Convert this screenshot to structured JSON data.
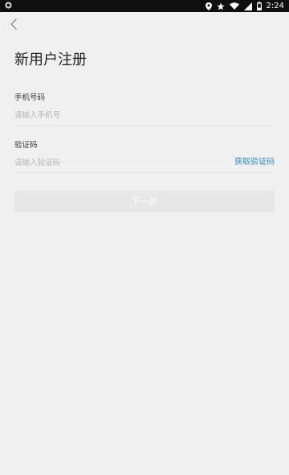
{
  "status_bar": {
    "time": "2:24",
    "icons": [
      "app-notification-icon",
      "location-icon",
      "star-icon",
      "wifi-icon",
      "signal-icon",
      "battery-icon"
    ]
  },
  "nav": {
    "back_icon": "chevron-left-icon"
  },
  "page": {
    "title": "新用户注册"
  },
  "form": {
    "phone": {
      "label": "手机号码",
      "placeholder": "请输入手机号",
      "value": ""
    },
    "code": {
      "label": "验证码",
      "placeholder": "请输入验证码",
      "value": "",
      "get_code_label": "获取验证码"
    },
    "next_label": "下一步"
  },
  "colors": {
    "background": "#f0f0f0",
    "link": "#2a8bd0",
    "button_disabled": "#e7e7e7"
  }
}
